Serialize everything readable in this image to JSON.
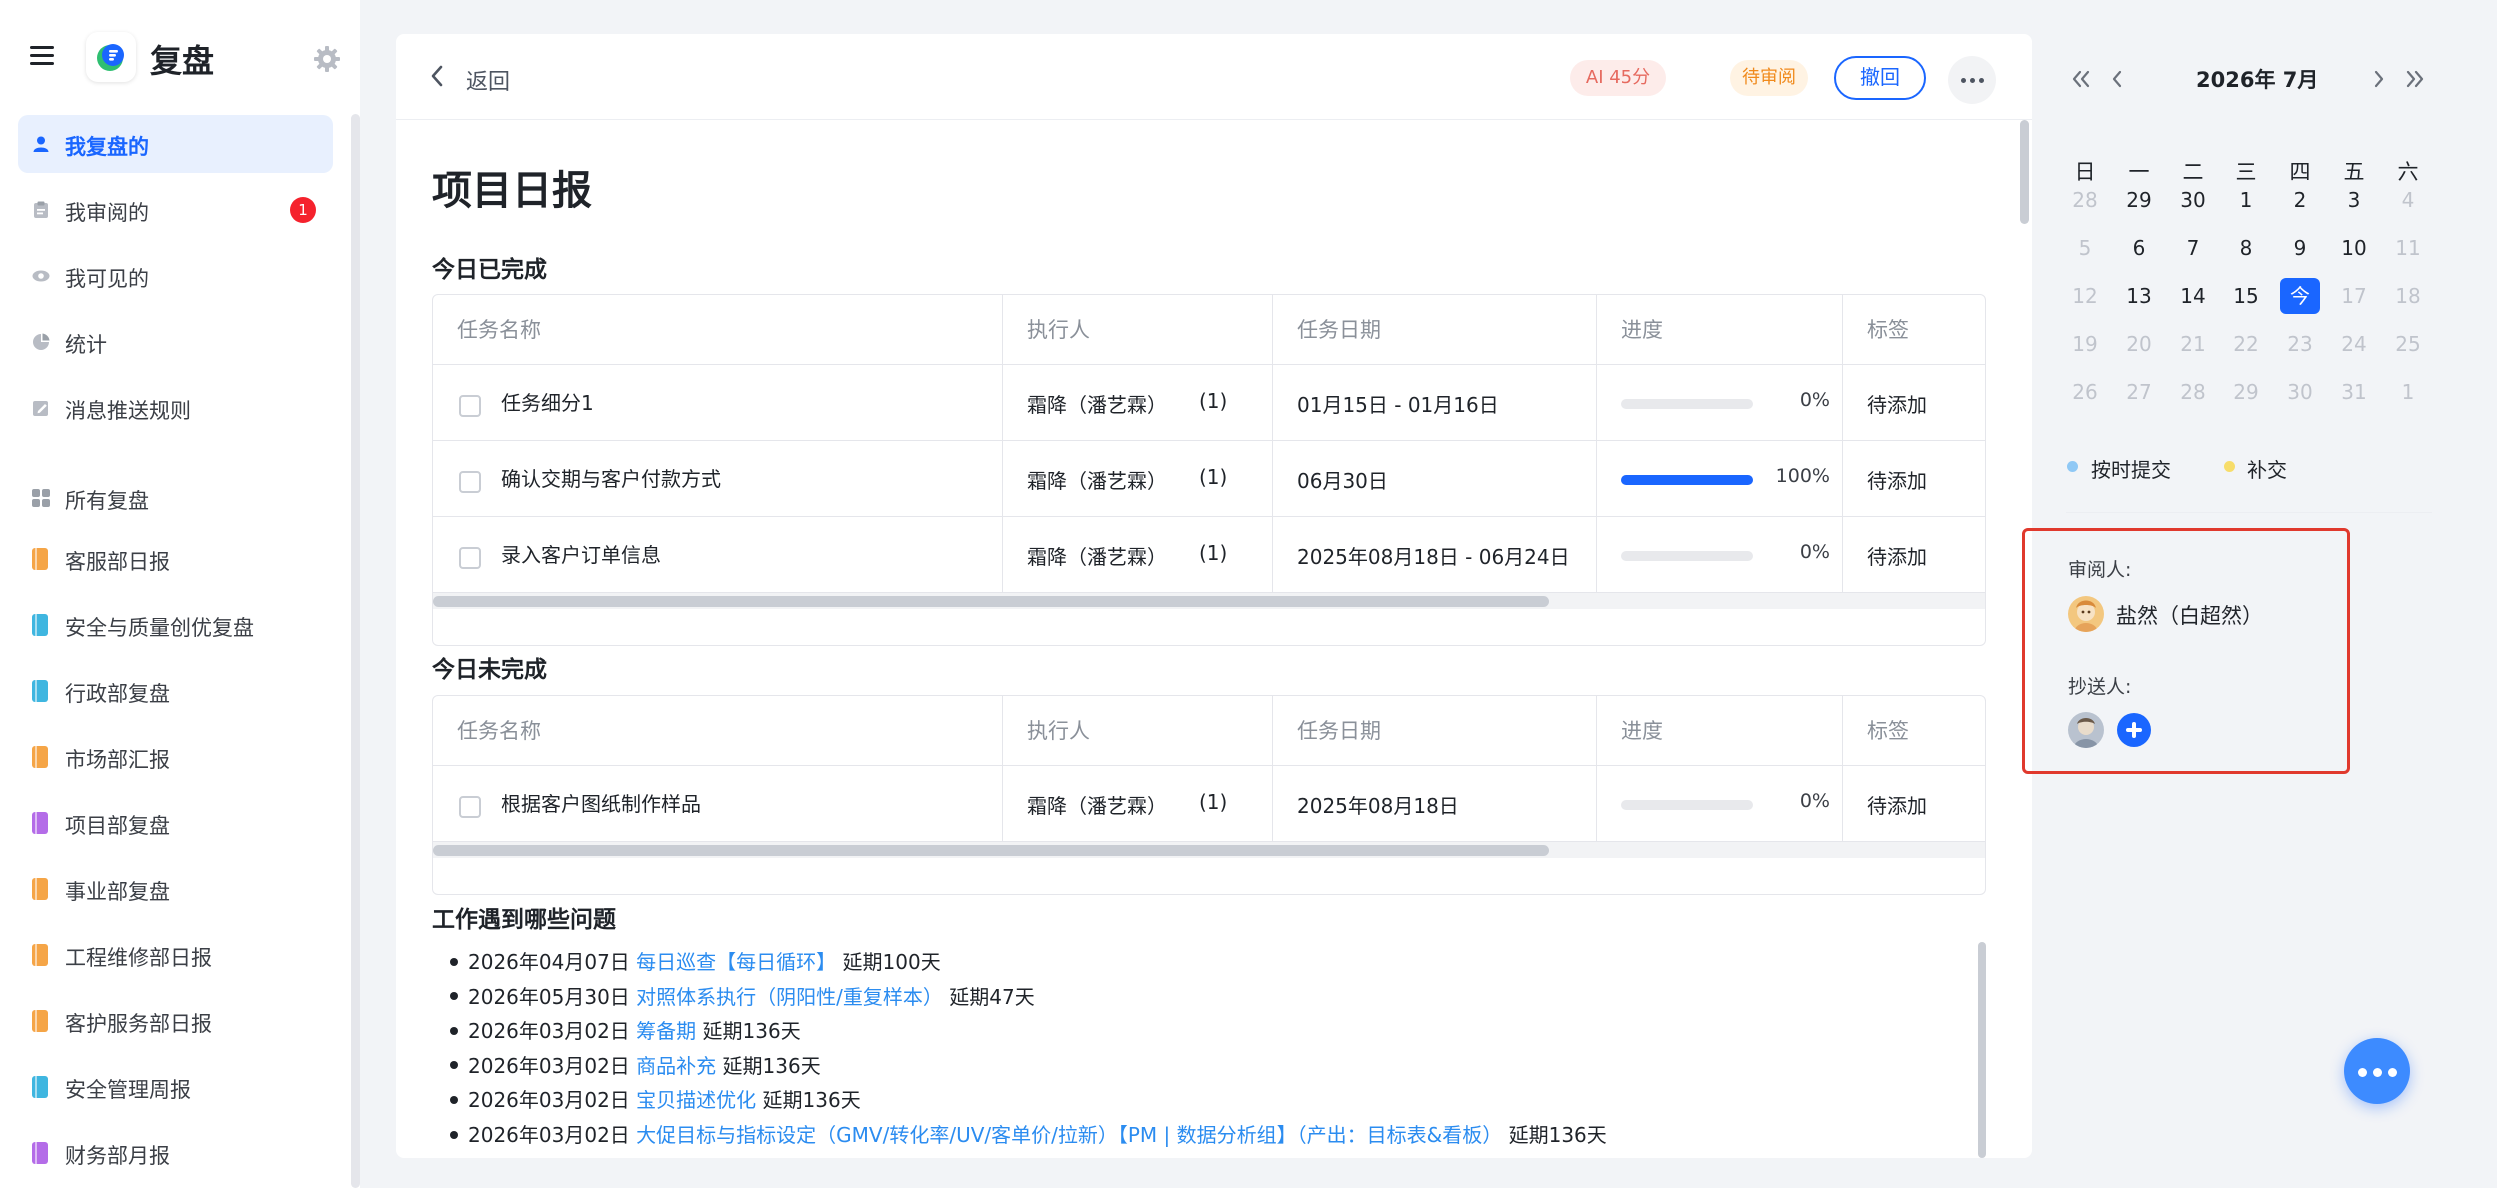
{
  "app": {
    "title": "复盘"
  },
  "sidebar": {
    "items": [
      {
        "label": "我复盘的",
        "active": true
      },
      {
        "label": "我审阅的",
        "badge": "1"
      },
      {
        "label": "我可见的"
      },
      {
        "label": "统计"
      },
      {
        "label": "消息推送规则"
      }
    ],
    "all_label": "所有复盘",
    "groups": [
      {
        "label": "客服部日报",
        "color": "#f5a547"
      },
      {
        "label": "安全与质量创优复盘",
        "color": "#3fb6e0"
      },
      {
        "label": "行政部复盘",
        "color": "#3fb6e0"
      },
      {
        "label": "市场部汇报",
        "color": "#f5a547"
      },
      {
        "label": "项目部复盘",
        "color": "#b46ce8"
      },
      {
        "label": "事业部复盘",
        "color": "#f5a547"
      },
      {
        "label": "工程维修部日报",
        "color": "#f5a547"
      },
      {
        "label": "客护服务部日报",
        "color": "#f5a547"
      },
      {
        "label": "安全管理周报",
        "color": "#3fb6e0"
      },
      {
        "label": "财务部月报",
        "color": "#b46ce8"
      }
    ]
  },
  "header": {
    "back_label": "返回",
    "ai_score": "AI 45分",
    "status": "待审阅",
    "revoke_label": "撤回"
  },
  "page": {
    "title": "项目日报"
  },
  "completed": {
    "title": "今日已完成",
    "columns": [
      "任务名称",
      "执行人",
      "任务日期",
      "进度",
      "标签"
    ],
    "rows": [
      {
        "name": "任务细分1",
        "executor": "霜降（潘艺霖）",
        "count": "(1)",
        "date": "01月15日 - 01月16日",
        "progress": 0,
        "progress_text": "0%",
        "tag": "待添加"
      },
      {
        "name": "确认交期与客户付款方式",
        "executor": "霜降（潘艺霖）",
        "count": "(1)",
        "date": "06月30日",
        "progress": 100,
        "progress_text": "100%",
        "tag": "待添加"
      },
      {
        "name": "录入客户订单信息",
        "executor": "霜降（潘艺霖）",
        "count": "(1)",
        "date": "2025年08月18日 - 06月24日",
        "progress": 0,
        "progress_text": "0%",
        "tag": "待添加"
      }
    ]
  },
  "incomplete": {
    "title": "今日未完成",
    "columns": [
      "任务名称",
      "执行人",
      "任务日期",
      "进度",
      "标签"
    ],
    "rows": [
      {
        "name": "根据客户图纸制作样品",
        "executor": "霜降（潘艺霖）",
        "count": "(1)",
        "date": "2025年08月18日",
        "progress": 0,
        "progress_text": "0%",
        "tag": "待添加"
      }
    ]
  },
  "issues": {
    "title": "工作遇到哪些问题",
    "items": [
      {
        "date": "2026年04月07日",
        "link": "每日巡查【每日循环】",
        "delay": "延期100天"
      },
      {
        "date": "2026年05月30日",
        "link": "对照体系执行（阴阳性/重复样本）",
        "delay": "延期47天"
      },
      {
        "date": "2026年03月02日",
        "link": "筹备期",
        "delay": "延期136天"
      },
      {
        "date": "2026年03月02日",
        "link": "商品补充",
        "delay": "延期136天"
      },
      {
        "date": "2026年03月02日",
        "link": "宝贝描述优化",
        "delay": "延期136天"
      },
      {
        "date": "2026年03月02日",
        "link": "大促目标与指标设定（GMV/转化率/UV/客单价/拉新）【PM | 数据分析组】（产出：目标表&看板）",
        "delay": "延期136天"
      }
    ]
  },
  "calendar": {
    "title": "2026年 7月",
    "weekdays": [
      "日",
      "一",
      "二",
      "三",
      "四",
      "五",
      "六"
    ],
    "weeks": [
      [
        {
          "d": "28",
          "m": true
        },
        {
          "d": "29"
        },
        {
          "d": "30"
        },
        {
          "d": "1"
        },
        {
          "d": "2"
        },
        {
          "d": "3"
        },
        {
          "d": "4",
          "m": true
        }
      ],
      [
        {
          "d": "5",
          "m": true
        },
        {
          "d": "6"
        },
        {
          "d": "7"
        },
        {
          "d": "8"
        },
        {
          "d": "9"
        },
        {
          "d": "10"
        },
        {
          "d": "11",
          "m": true
        }
      ],
      [
        {
          "d": "12",
          "m": true
        },
        {
          "d": "13"
        },
        {
          "d": "14"
        },
        {
          "d": "15"
        },
        {
          "d": "今",
          "today": true
        },
        {
          "d": "17",
          "m": true
        },
        {
          "d": "18",
          "m": true
        }
      ],
      [
        {
          "d": "19",
          "m": true
        },
        {
          "d": "20",
          "m": true
        },
        {
          "d": "21",
          "m": true
        },
        {
          "d": "22",
          "m": true
        },
        {
          "d": "23",
          "m": true
        },
        {
          "d": "24",
          "m": true
        },
        {
          "d": "25",
          "m": true
        }
      ],
      [
        {
          "d": "26",
          "m": true
        },
        {
          "d": "27",
          "m": true
        },
        {
          "d": "28",
          "m": true
        },
        {
          "d": "29",
          "m": true
        },
        {
          "d": "30",
          "m": true
        },
        {
          "d": "31",
          "m": true
        },
        {
          "d": "1",
          "m": true
        }
      ]
    ],
    "legend": [
      {
        "label": "按时提交",
        "color": "#8fc8f5"
      },
      {
        "label": "补交",
        "color": "#f7dd6a"
      }
    ]
  },
  "review": {
    "reviewer_label": "审阅人:",
    "reviewer_name": "盐然（白超然）",
    "cc_label": "抄送人:"
  },
  "colors": {
    "accent": "#1a66ff",
    "danger": "#f5222d",
    "highlight_border": "#e0392d"
  }
}
